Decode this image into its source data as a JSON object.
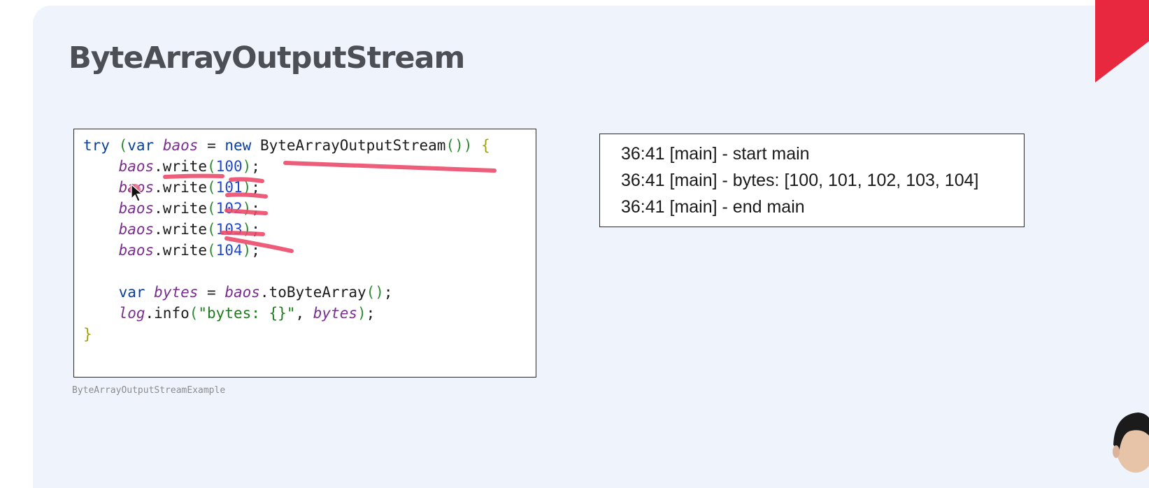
{
  "slide": {
    "title": "ByteArrayOutputStream"
  },
  "code": {
    "caption": "ByteArrayOutputStreamExample",
    "lines": [
      "try (var baos = new ByteArrayOutputStream()) {",
      "    baos.write(100);",
      "    baos.write(101);",
      "    baos.write(102);",
      "    baos.write(103);",
      "    baos.write(104);",
      "",
      "    var bytes = baos.toByteArray();",
      "    log.info(\"bytes: {}\", bytes);",
      "}"
    ]
  },
  "console": {
    "lines": [
      "36:41 [main] - start main",
      "36:41 [main] - bytes: [100, 101, 102, 103, 104]",
      "36:41 [main] - end main"
    ]
  },
  "colors": {
    "slide_background": "#eef3fc",
    "accent_corner": "#e8283f",
    "annotation_marker": "#ec4b6a",
    "keyword": "#0b3f99",
    "variable": "#7a2f8f",
    "number": "#2348c9"
  },
  "icons": {
    "cursor": "mouse-pointer-icon"
  }
}
